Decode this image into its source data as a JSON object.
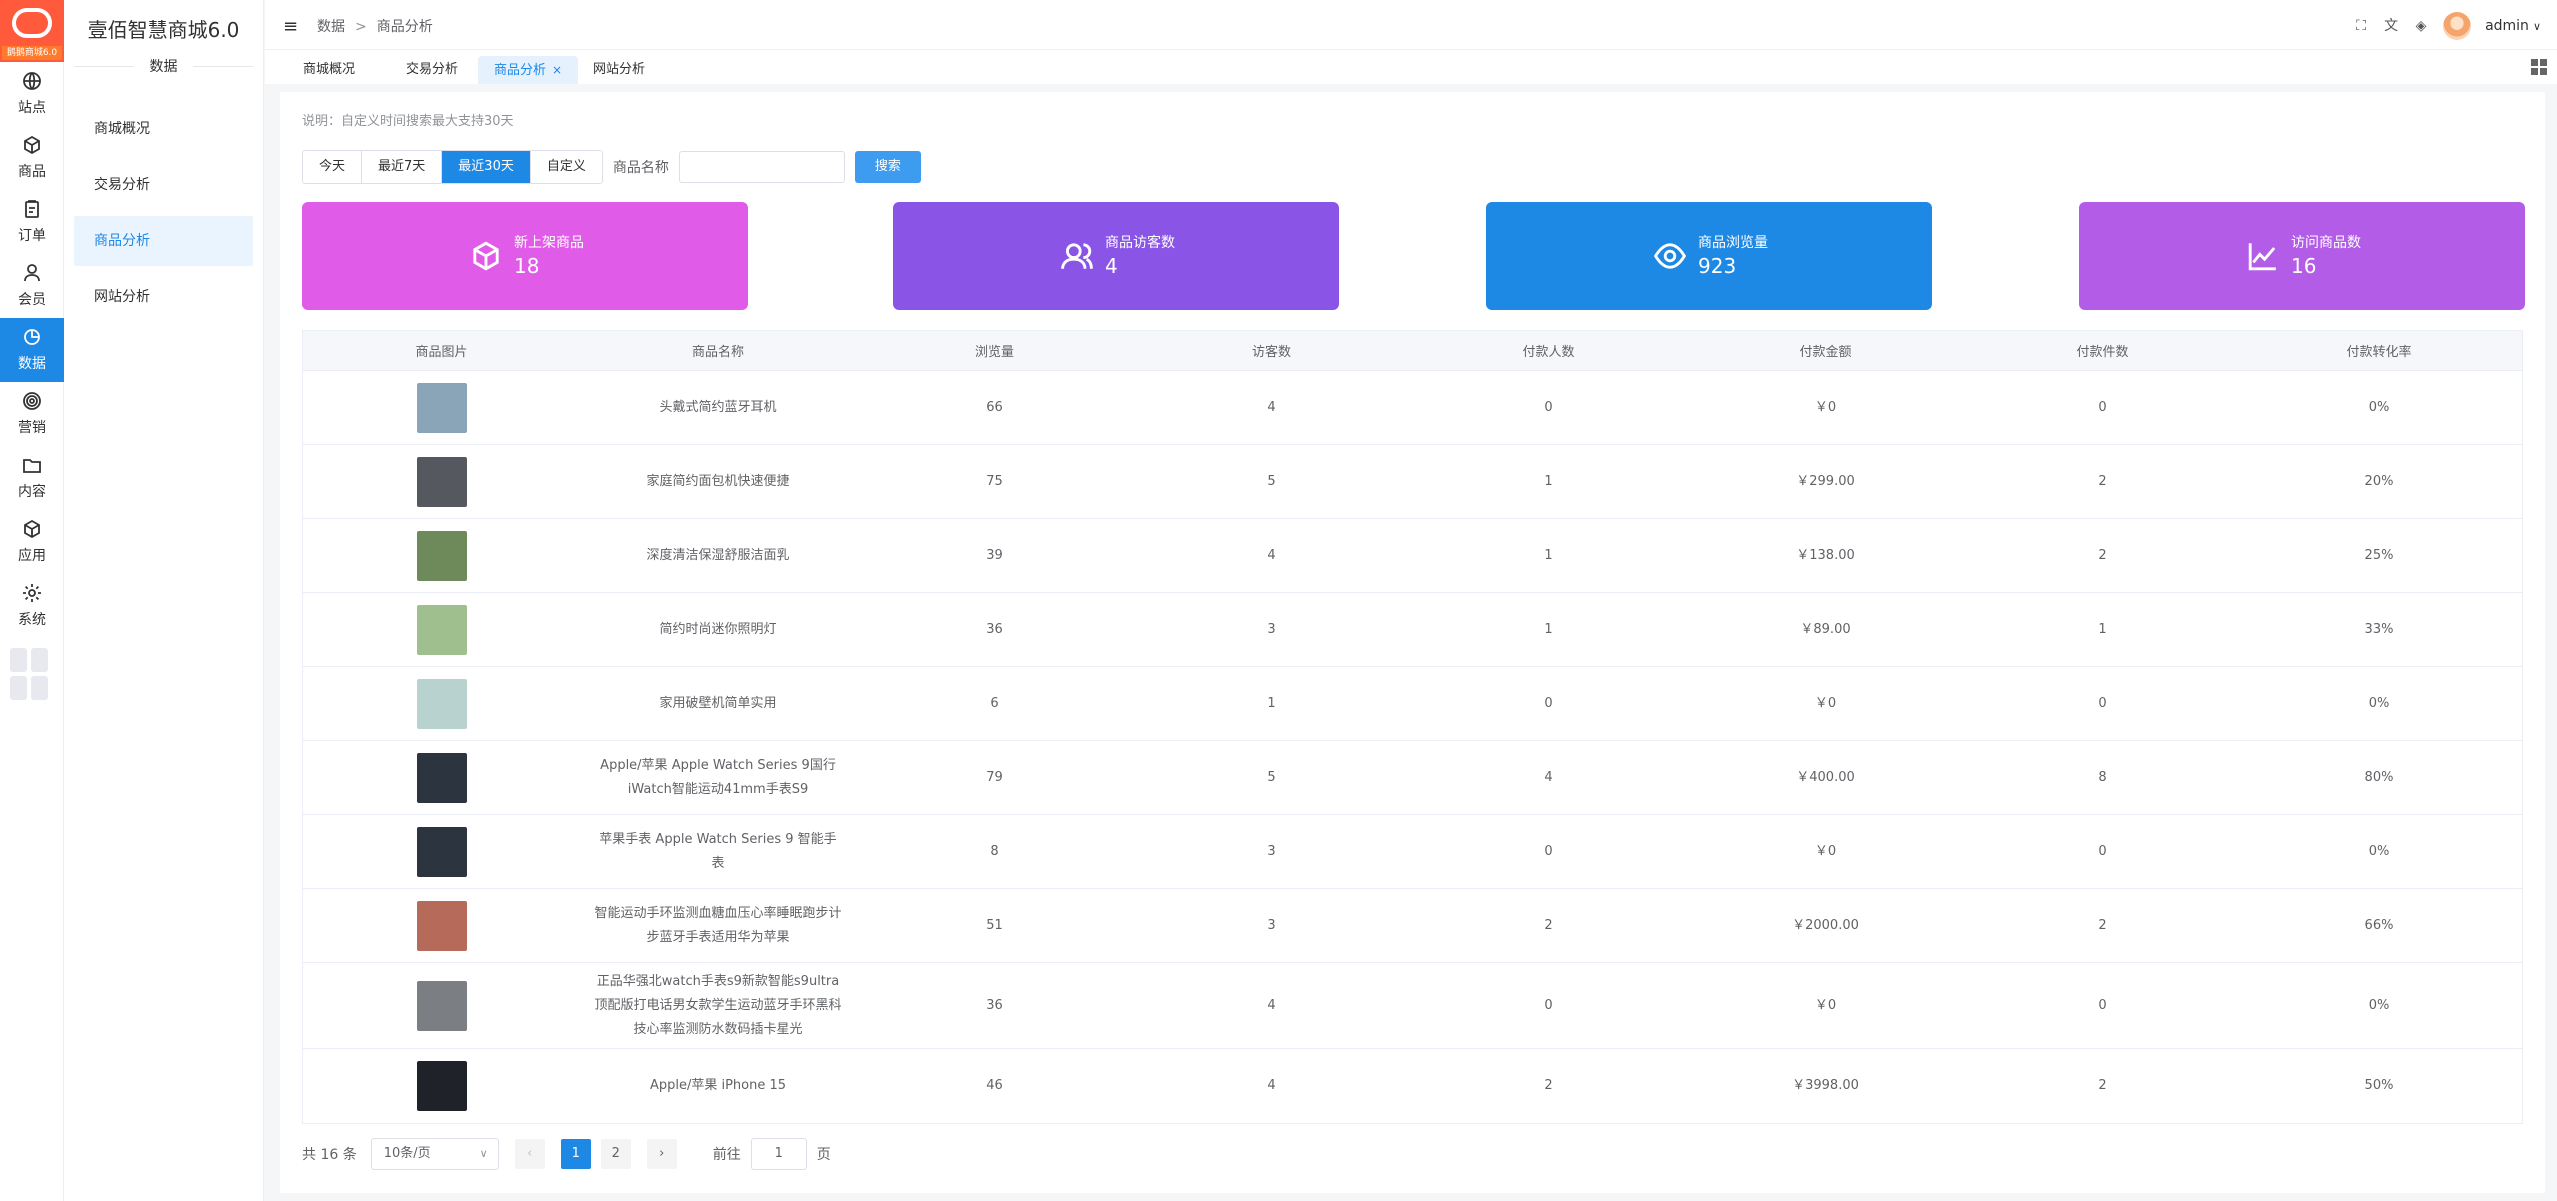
{
  "rail": {
    "logo_tag": "鹅鹅商城6.0",
    "items": [
      {
        "label": "站点",
        "icon": "globe-icon"
      },
      {
        "label": "商品",
        "icon": "box-icon"
      },
      {
        "label": "订单",
        "icon": "clipboard-icon"
      },
      {
        "label": "会员",
        "icon": "user-icon"
      },
      {
        "label": "数据",
        "icon": "pie-chart-icon",
        "active": true
      },
      {
        "label": "营销",
        "icon": "target-icon"
      },
      {
        "label": "内容",
        "icon": "folder-icon"
      },
      {
        "label": "应用",
        "icon": "cube-icon"
      },
      {
        "label": "系统",
        "icon": "gear-icon"
      }
    ]
  },
  "sidebar": {
    "title": "壹佰智慧商城6.0",
    "section": "数据",
    "items": [
      "商城概况",
      "交易分析",
      "商品分析",
      "网站分析"
    ],
    "active_index": 2
  },
  "header": {
    "breadcrumb": [
      "数据",
      "商品分析"
    ],
    "separator": ">",
    "user": "admin"
  },
  "tabs": {
    "items": [
      "商城概况",
      "交易分析",
      "商品分析",
      "网站分析"
    ],
    "active_index": 2,
    "close_glyph": "×"
  },
  "filters": {
    "note": "说明：自定义时间搜索最大支持30天",
    "ranges": [
      "今天",
      "最近7天",
      "最近30天",
      "自定义"
    ],
    "active_range": 2,
    "name_label": "商品名称",
    "name_value": "",
    "search_label": "搜索"
  },
  "cards": [
    {
      "title": "新上架商品",
      "value": "18",
      "color": "#e05ce8",
      "icon": "cube-icon"
    },
    {
      "title": "商品访客数",
      "value": "4",
      "color": "#8a55e6",
      "icon": "users-icon"
    },
    {
      "title": "商品浏览量",
      "value": "923",
      "color": "#1e88e5",
      "icon": "eye-icon"
    },
    {
      "title": "访问商品数",
      "value": "16",
      "color": "#b25ce8",
      "icon": "line-chart-icon"
    }
  ],
  "table": {
    "headers": [
      "商品图片",
      "商品名称",
      "浏览量",
      "访客数",
      "付款人数",
      "付款金额",
      "付款件数",
      "付款转化率"
    ],
    "rows": [
      {
        "name": "头戴式简约蓝牙耳机",
        "views": "66",
        "visitors": "4",
        "payers": "0",
        "amount": "￥0",
        "qty": "0",
        "rate": "0%",
        "thumb": "#8aa5b8"
      },
      {
        "name": "家庭简约面包机快速便捷",
        "views": "75",
        "visitors": "5",
        "payers": "1",
        "amount": "￥299.00",
        "qty": "2",
        "rate": "20%",
        "thumb": "#55585e"
      },
      {
        "name": "深度清洁保湿舒服洁面乳",
        "views": "39",
        "visitors": "4",
        "payers": "1",
        "amount": "￥138.00",
        "qty": "2",
        "rate": "25%",
        "thumb": "#6f8a5a"
      },
      {
        "name": "简约时尚迷你照明灯",
        "views": "36",
        "visitors": "3",
        "payers": "1",
        "amount": "￥89.00",
        "qty": "1",
        "rate": "33%",
        "thumb": "#9fbf8f"
      },
      {
        "name": "家用破壁机简单实用",
        "views": "6",
        "visitors": "1",
        "payers": "0",
        "amount": "￥0",
        "qty": "0",
        "rate": "0%",
        "thumb": "#b8d2d0"
      },
      {
        "name": "Apple/苹果 Apple Watch Series 9国行iWatch智能运动41mm手表S9",
        "views": "79",
        "visitors": "5",
        "payers": "4",
        "amount": "￥400.00",
        "qty": "8",
        "rate": "80%",
        "thumb": "#2c3440"
      },
      {
        "name": "苹果手表 Apple Watch Series 9 智能手表",
        "views": "8",
        "visitors": "3",
        "payers": "0",
        "amount": "￥0",
        "qty": "0",
        "rate": "0%",
        "thumb": "#2c3440"
      },
      {
        "name": "智能运动手环监测血糖血压心率睡眠跑步计步蓝牙手表适用华为苹果",
        "views": "51",
        "visitors": "3",
        "payers": "2",
        "amount": "￥2000.00",
        "qty": "2",
        "rate": "66%",
        "thumb": "#b66a5a"
      },
      {
        "name": "正品华强北watch手表s9新款智能s9ultra顶配版打电话男女款学生运动蓝牙手环黑科技心率监测防水数码插卡星光",
        "views": "36",
        "visitors": "4",
        "payers": "0",
        "amount": "￥0",
        "qty": "0",
        "rate": "0%",
        "thumb": "#7b7f84"
      },
      {
        "name": "Apple/苹果 iPhone 15",
        "views": "46",
        "visitors": "4",
        "payers": "2",
        "amount": "￥3998.00",
        "qty": "2",
        "rate": "50%",
        "thumb": "#1f2329"
      }
    ]
  },
  "pagination": {
    "total": "共 16 条",
    "page_size": "10条/页",
    "pages": [
      "1",
      "2"
    ],
    "current": 1,
    "prev": "‹",
    "next": "›",
    "goto_label": "前往",
    "goto_value": "1",
    "goto_unit": "页"
  }
}
